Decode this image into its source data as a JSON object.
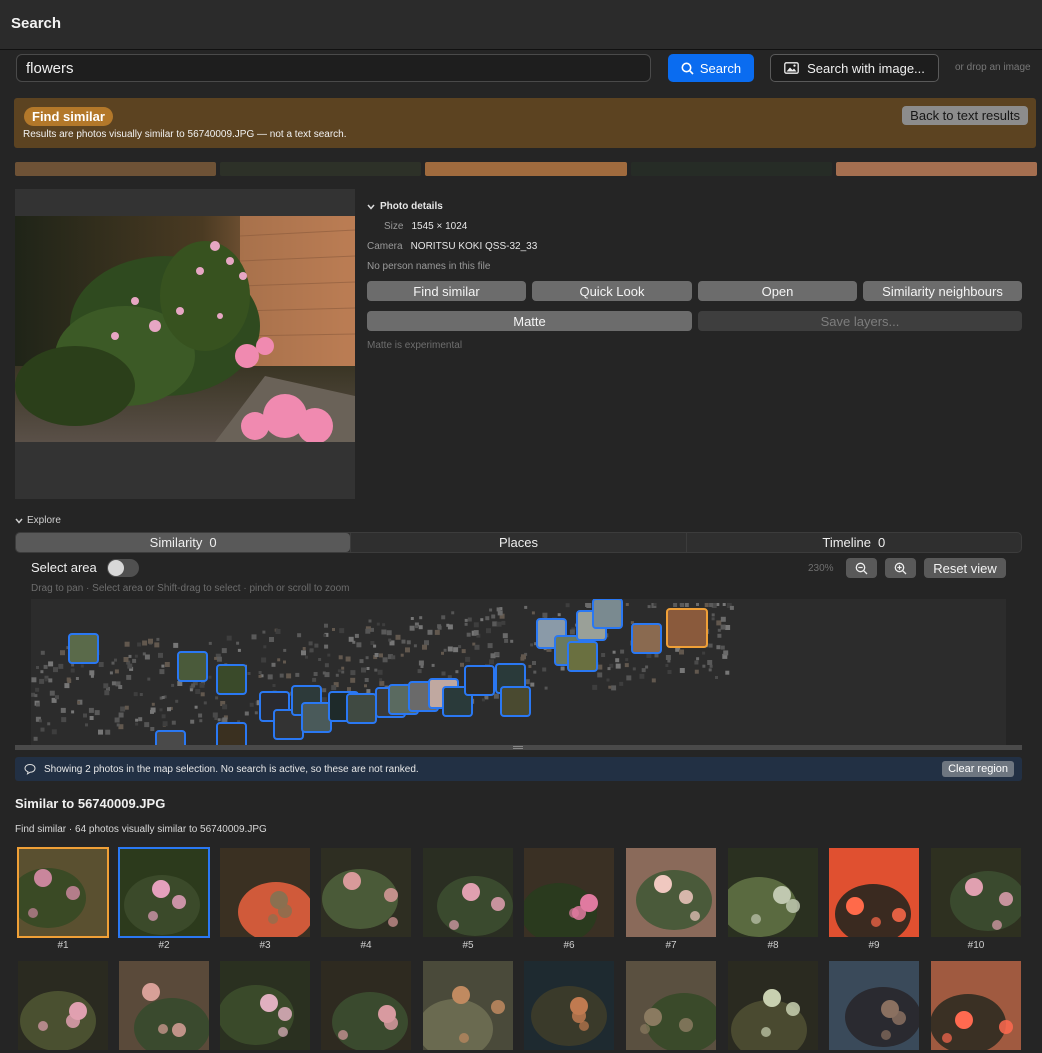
{
  "window": {
    "title": "Search"
  },
  "search": {
    "query": "flowers",
    "button_label": "Search",
    "image_button_label": "Search with image...",
    "drop_hint": "or drop an image"
  },
  "banner": {
    "badge": "Find similar",
    "subtitle": "Results are photos visually similar to 56740009.JPG — not a text search.",
    "back_label": "Back to text results"
  },
  "swatches": [
    "#6e5236",
    "#2d3128",
    "#a06b3e",
    "#262c26",
    "#a56f50"
  ],
  "details": {
    "section_label": "Photo details",
    "size_key": "Size",
    "size_value": "1545 × 1024",
    "camera_key": "Camera",
    "camera_value": "NORITSU KOKI QSS-32_33",
    "no_person": "No person names in this file",
    "buttons": {
      "find_similar": "Find similar",
      "quick_look": "Quick Look",
      "open": "Open",
      "neighbours": "Similarity neighbours",
      "matte": "Matte",
      "save_layers": "Save layers..."
    },
    "matte_note": "Matte is experimental"
  },
  "explore": {
    "label": "Explore",
    "tabs": [
      {
        "label": "Similarity",
        "count": "0"
      },
      {
        "label": "Places",
        "count": ""
      },
      {
        "label": "Timeline",
        "count": "0"
      }
    ],
    "select_area_label": "Select area",
    "zoom_level": "230%",
    "reset_label": "Reset view",
    "hint": "Drag to pan · Select area or Shift-drag to select · pinch or scroll to zoom"
  },
  "info": {
    "message": "Showing 2 photos in the map selection. No search is active, so these are not ranked.",
    "clear_label": "Clear region"
  },
  "results": {
    "title": "Similar to 56740009.JPG",
    "subtitle": "Find similar · 64 photos visually similar to 56740009.JPG",
    "row1_labels": [
      "#1",
      "#2",
      "#3",
      "#4",
      "#5",
      "#6",
      "#7",
      "#8",
      "#9",
      "#10"
    ]
  },
  "colors": {
    "accent": "#0a6cf0",
    "banner": "#5c4321",
    "selection_orange": "#f0a037",
    "selection_blue": "#2a78f3"
  }
}
